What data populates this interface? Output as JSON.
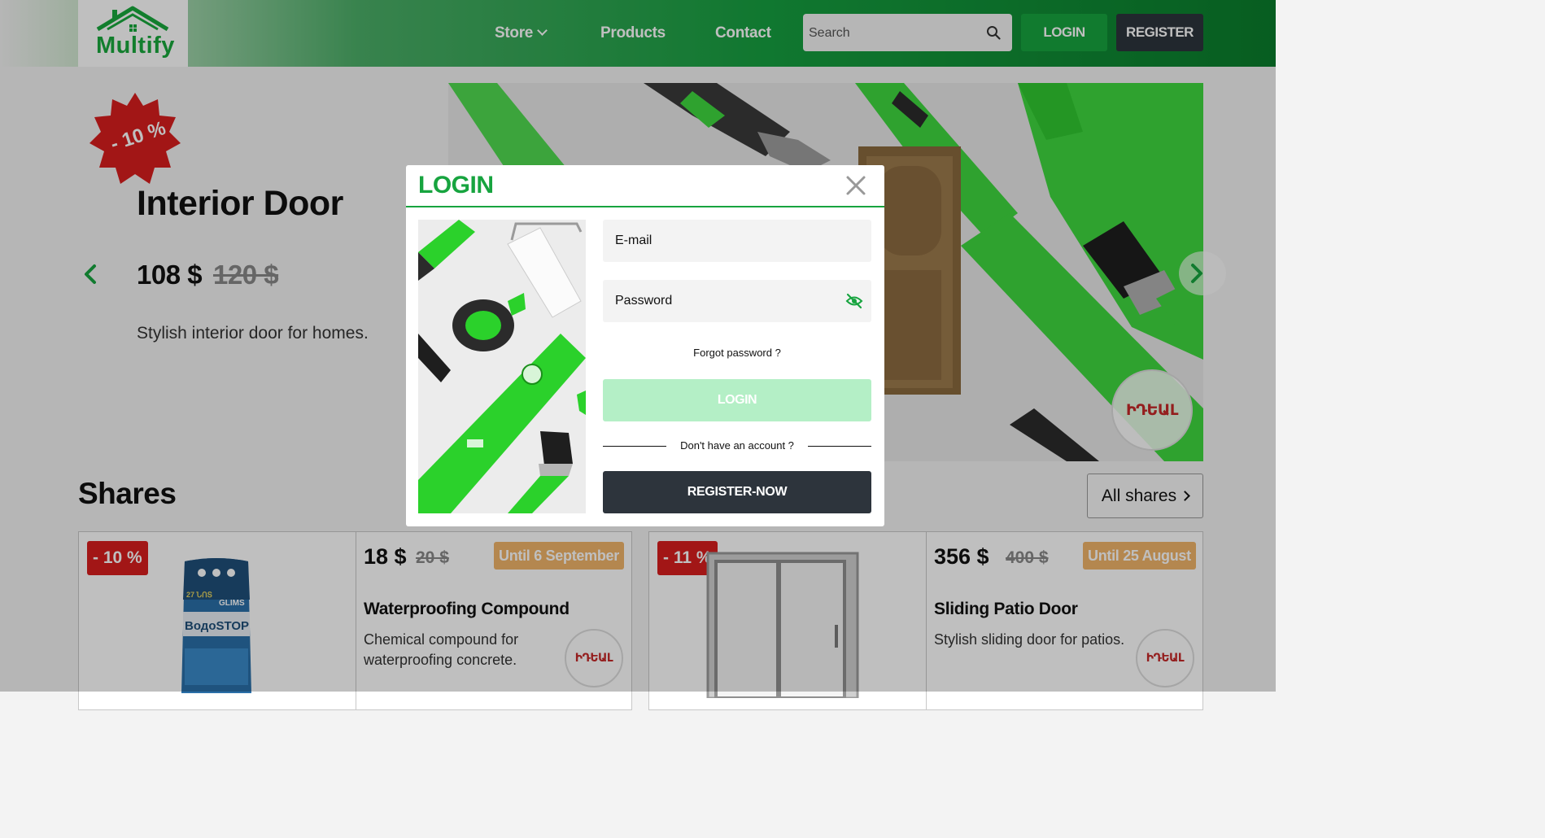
{
  "header": {
    "logo_text": "Multify",
    "nav": {
      "store": "Store",
      "products": "Products",
      "contact": "Contact"
    },
    "search": {
      "placeholder": "Search",
      "value": ""
    },
    "login_label": "LOGIN",
    "register_label": "REGISTER"
  },
  "hero": {
    "discount": "- 10 %",
    "title": "Interior Door",
    "price": "108 $",
    "old_price": "120 $",
    "description": "Stylish interior door for homes.",
    "brand": "ԻԴԵԱԼ"
  },
  "shares": {
    "title": "Shares",
    "all_label": "All shares",
    "cards": [
      {
        "discount": "- 10 %",
        "price": "18 $",
        "old_price": "20 $",
        "until": "Until 6 September",
        "name": "Waterproofing Compound",
        "description": "Chemical compound for waterproofing concrete.",
        "brand": "ԻԴԵԱԼ",
        "package_lines": [
          "27 ՆՈՏ",
          "GLIMS",
          "ВодоSTOP"
        ]
      },
      {
        "discount": "- 11 %",
        "price": "356 $",
        "old_price": "400 $",
        "until": "Until 25 August",
        "name": "Sliding Patio Door",
        "description": "Stylish sliding door for patios.",
        "brand": "ԻԴԵԱԼ"
      }
    ]
  },
  "modal": {
    "title": "LOGIN",
    "email_placeholder": "E-mail",
    "password_placeholder": "Password",
    "forgot": "Forgot password ?",
    "login_label": "LOGIN",
    "no_account": "Don't have an account ?",
    "register_label": "REGISTER-NOW"
  },
  "colors": {
    "brand_green": "#17a43f",
    "light_green": "#b4efc6",
    "dark": "#2d343c",
    "discount_red": "#d81e1e",
    "until_orange": "#f0b46a"
  }
}
